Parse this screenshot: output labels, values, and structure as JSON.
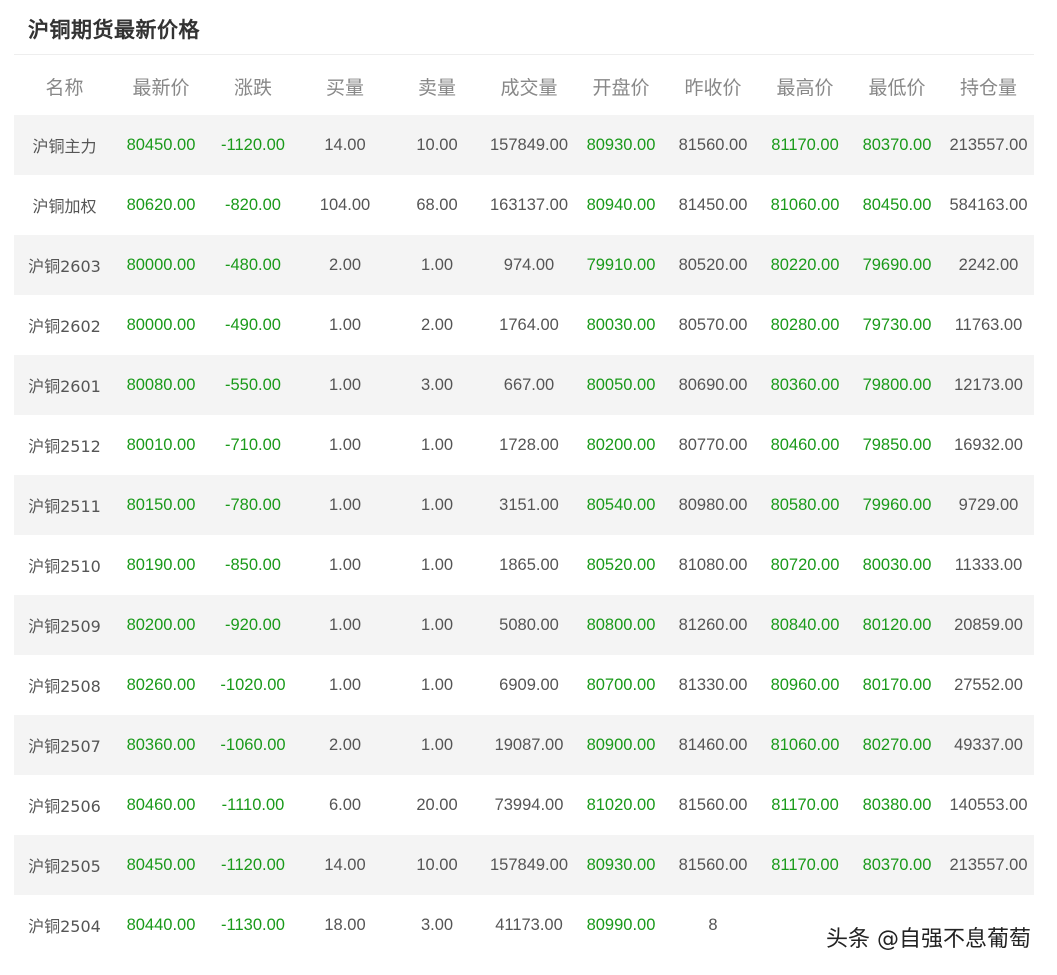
{
  "title": "沪铜期货最新价格",
  "columns": [
    "名称",
    "最新价",
    "涨跌",
    "买量",
    "卖量",
    "成交量",
    "开盘价",
    "昨收价",
    "最高价",
    "最低价",
    "持仓量"
  ],
  "rows": [
    [
      "沪铜主力",
      "80450.00",
      "-1120.00",
      "14.00",
      "10.00",
      "157849.00",
      "80930.00",
      "81560.00",
      "81170.00",
      "80370.00",
      "213557.00"
    ],
    [
      "沪铜加权",
      "80620.00",
      "-820.00",
      "104.00",
      "68.00",
      "163137.00",
      "80940.00",
      "81450.00",
      "81060.00",
      "80450.00",
      "584163.00"
    ],
    [
      "沪铜2603",
      "80000.00",
      "-480.00",
      "2.00",
      "1.00",
      "974.00",
      "79910.00",
      "80520.00",
      "80220.00",
      "79690.00",
      "2242.00"
    ],
    [
      "沪铜2602",
      "80000.00",
      "-490.00",
      "1.00",
      "2.00",
      "1764.00",
      "80030.00",
      "80570.00",
      "80280.00",
      "79730.00",
      "11763.00"
    ],
    [
      "沪铜2601",
      "80080.00",
      "-550.00",
      "1.00",
      "3.00",
      "667.00",
      "80050.00",
      "80690.00",
      "80360.00",
      "79800.00",
      "12173.00"
    ],
    [
      "沪铜2512",
      "80010.00",
      "-710.00",
      "1.00",
      "1.00",
      "1728.00",
      "80200.00",
      "80770.00",
      "80460.00",
      "79850.00",
      "16932.00"
    ],
    [
      "沪铜2511",
      "80150.00",
      "-780.00",
      "1.00",
      "1.00",
      "3151.00",
      "80540.00",
      "80980.00",
      "80580.00",
      "79960.00",
      "9729.00"
    ],
    [
      "沪铜2510",
      "80190.00",
      "-850.00",
      "1.00",
      "1.00",
      "1865.00",
      "80520.00",
      "81080.00",
      "80720.00",
      "80030.00",
      "11333.00"
    ],
    [
      "沪铜2509",
      "80200.00",
      "-920.00",
      "1.00",
      "1.00",
      "5080.00",
      "80800.00",
      "81260.00",
      "80840.00",
      "80120.00",
      "20859.00"
    ],
    [
      "沪铜2508",
      "80260.00",
      "-1020.00",
      "1.00",
      "1.00",
      "6909.00",
      "80700.00",
      "81330.00",
      "80960.00",
      "80170.00",
      "27552.00"
    ],
    [
      "沪铜2507",
      "80360.00",
      "-1060.00",
      "2.00",
      "1.00",
      "19087.00",
      "80900.00",
      "81460.00",
      "81060.00",
      "80270.00",
      "49337.00"
    ],
    [
      "沪铜2506",
      "80460.00",
      "-1110.00",
      "6.00",
      "20.00",
      "73994.00",
      "81020.00",
      "81560.00",
      "81170.00",
      "80380.00",
      "140553.00"
    ],
    [
      "沪铜2505",
      "80450.00",
      "-1120.00",
      "14.00",
      "10.00",
      "157849.00",
      "80930.00",
      "81560.00",
      "81170.00",
      "80370.00",
      "213557.00"
    ],
    [
      "沪铜2504",
      "80440.00",
      "-1130.00",
      "18.00",
      "3.00",
      "41173.00",
      "80990.00",
      "8",
      "",
      "",
      ""
    ]
  ],
  "green_columns": [
    1,
    2,
    6,
    8,
    9
  ],
  "colors": {
    "price_green": "#1a9a1a",
    "stripe": "#f4f4f4",
    "text": "#555555",
    "header": "#888888"
  },
  "watermark": "头条 @自强不息葡萄"
}
